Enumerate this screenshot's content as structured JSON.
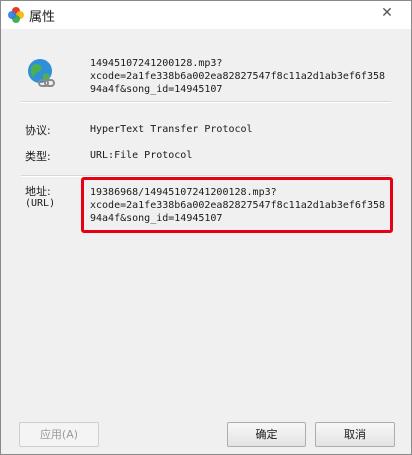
{
  "window": {
    "title": "属性",
    "close_glyph": "✕"
  },
  "file": {
    "icon": "globe-link-icon",
    "name_lines": [
      "14945107241200128.mp3?",
      "xcode=2a1fe338b6a002ea82827547f8c11a2d1ab3ef6f358",
      "94a4f&song_id=14945107"
    ]
  },
  "properties": {
    "protocol_label": "协议:",
    "protocol_value": "HyperText Transfer Protocol",
    "type_label": "类型:",
    "type_value": "URL:File Protocol",
    "address_label": "地址:",
    "address_sub": "(URL)",
    "address_lines": [
      "19386968/14945107241200128.mp3?",
      "xcode=2a1fe338b6a002ea82827547f8c11a2d1ab3ef6f358",
      "94a4f&song_id=14945107"
    ]
  },
  "buttons": {
    "apply": "应用(A)",
    "ok": "确定",
    "cancel": "取消"
  },
  "colors": {
    "highlight": "#e60012"
  }
}
